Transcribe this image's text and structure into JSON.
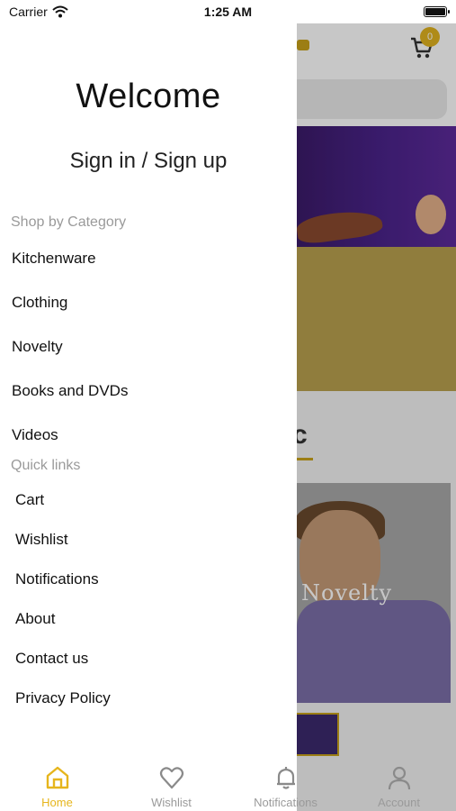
{
  "status_bar": {
    "carrier": "Carrier",
    "time": "1:25 AM"
  },
  "background": {
    "cart_count": "0",
    "banner_text": "Novelty",
    "section_partial_letter": "c"
  },
  "drawer": {
    "welcome": "Welcome",
    "sign_in": "Sign in / Sign up",
    "categories_header": "Shop by Category",
    "categories": [
      "Kitchenware",
      "Clothing",
      "Novelty",
      "Books and DVDs",
      "Videos"
    ],
    "quick_links_header": "Quick links",
    "quick_links": [
      "Cart",
      "Wishlist",
      "Notifications",
      "About",
      "Contact us",
      "Privacy Policy"
    ]
  },
  "tabbar": {
    "tabs": [
      {
        "label": "Home",
        "icon": "home-icon",
        "active": true
      },
      {
        "label": "Wishlist",
        "icon": "heart-icon",
        "active": false
      },
      {
        "label": "Notifications",
        "icon": "bell-icon",
        "active": false
      },
      {
        "label": "Account",
        "icon": "person-icon",
        "active": false
      }
    ]
  },
  "colors": {
    "accent": "#e6b51c",
    "mustard": "#b9a14f",
    "banner_purple": "#4a238a"
  }
}
